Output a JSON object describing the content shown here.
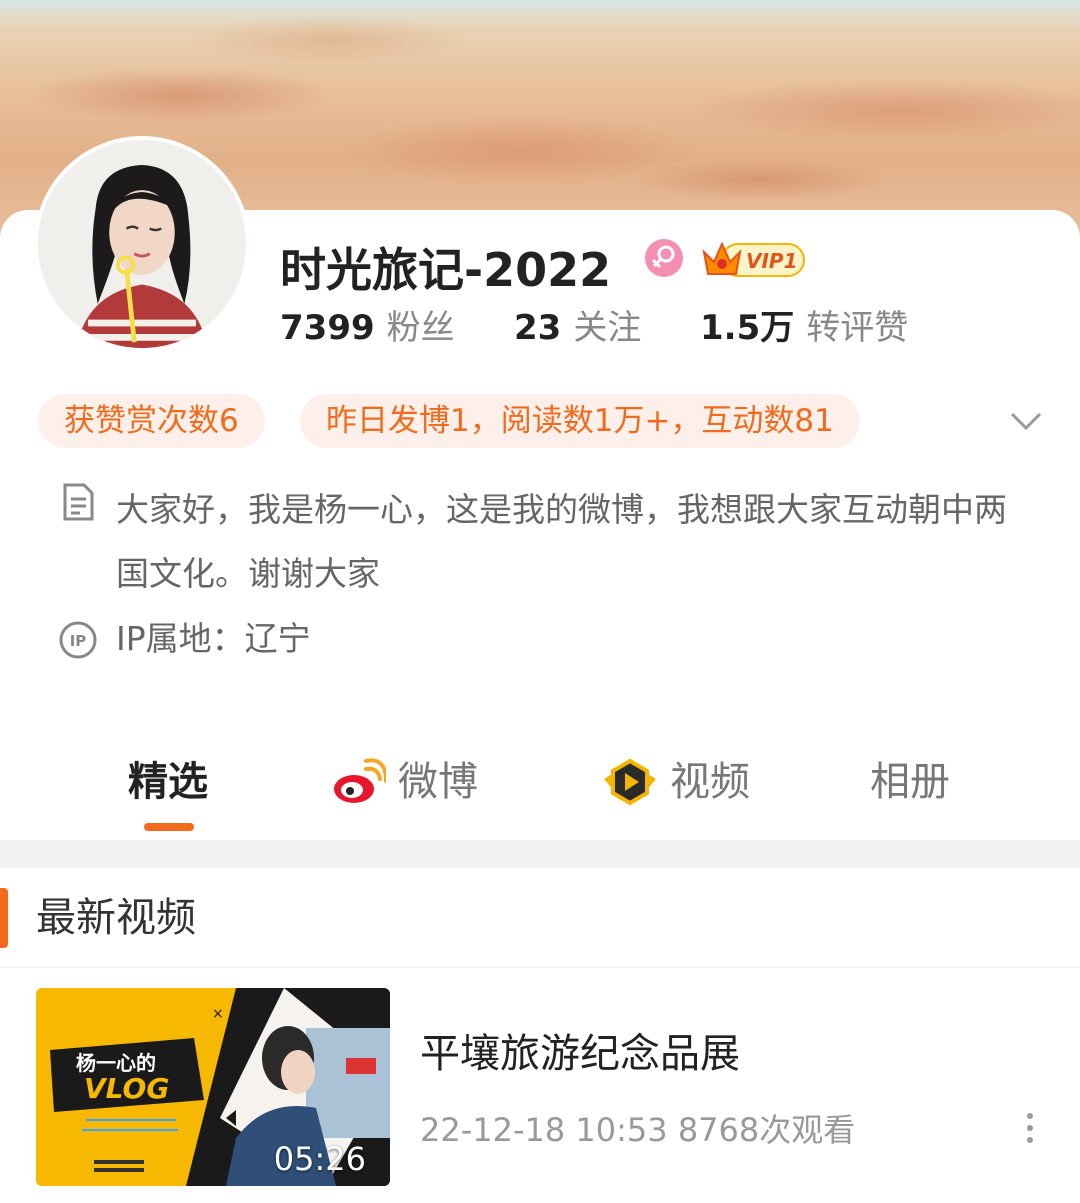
{
  "profile": {
    "name": "时光旅记-2022",
    "vip_label": "VIP1",
    "stats": [
      {
        "value": "7399",
        "label": "粉丝"
      },
      {
        "value": "23",
        "label": "关注"
      },
      {
        "value": "1.5万",
        "label": "转评赞"
      }
    ],
    "tags": [
      "获赞赏次数6",
      "昨日发博1，阅读数1万+，互动数81"
    ],
    "bio": "大家好，我是杨一心，这是我的微博，我想跟大家互动朝中两国文化。谢谢大家",
    "ip": "IP属地：辽宁"
  },
  "tabs": [
    {
      "label": "精选",
      "active": true
    },
    {
      "label": "微博",
      "icon": "weibo-icon"
    },
    {
      "label": "视频",
      "icon": "video-play-icon"
    },
    {
      "label": "相册"
    }
  ],
  "section": {
    "title": "最新视频"
  },
  "video": {
    "title": "平壤旅游纪念品展",
    "meta": "22-12-18 10:53 8768次观看",
    "duration": "05:26",
    "thumb_vlog_title": "杨一心的",
    "thumb_vlog_word": "VLOG",
    "thumb_close_mark": "×"
  },
  "colors": {
    "accent": "#f26b1d",
    "tag_bg": "#fdf0ea",
    "vip_gold": "#f5b400"
  }
}
